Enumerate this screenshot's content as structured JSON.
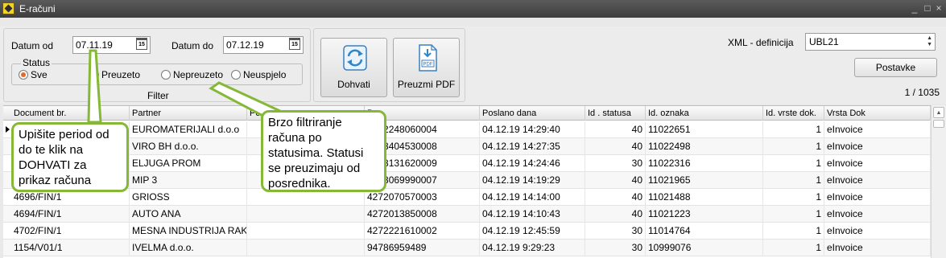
{
  "window": {
    "title": "E-računi",
    "controls": {
      "minimize": "_",
      "maximize": "□",
      "close": "×"
    }
  },
  "filter": {
    "date_from_label": "Datum od",
    "date_from_value": "07.11.19",
    "date_to_label": "Datum do",
    "date_to_value": "07.12.19",
    "calendar_glyph": "15",
    "status_label": "Status",
    "status_options": [
      {
        "label": "Sve",
        "selected": true
      },
      {
        "label": "Preuzeto",
        "selected": false
      },
      {
        "label": "Nepreuzeto",
        "selected": false
      },
      {
        "label": "Neuspjelo",
        "selected": false
      }
    ],
    "caption": "Filter"
  },
  "actions": {
    "fetch_label": "Dohvati",
    "download_pdf_label": "Preuzmi PDF",
    "pdf_icon_text": "PDF"
  },
  "xml": {
    "label": "XML - definicija",
    "value": "UBL21",
    "settings_label": "Postavke",
    "pager": "1 / 1035"
  },
  "table": {
    "columns": [
      "Document br.",
      "Partner",
      "Pos. je",
      "B",
      "Poslano dana",
      "Id . statusa",
      "Id. oznaka",
      "Id. vrste dok.",
      "Vrsta Dok"
    ],
    "rows": [
      {
        "doc": "",
        "partner": "EUROMATERIJALI d.o.o",
        "pos": "",
        "b": "4272248060004",
        "date": "04.12.19 14:29:40",
        "status": "40",
        "oznaka": "11022651",
        "vrste": "1",
        "vrsta": "eInvoice"
      },
      {
        "doc": "",
        "partner": "VIRO BH d.o.o.",
        "pos": "",
        "b": "4218404530008",
        "date": "04.12.19 14:27:35",
        "status": "40",
        "oznaka": "11022498",
        "vrste": "1",
        "vrsta": "eInvoice"
      },
      {
        "doc": "",
        "partner": "ELJUGA PROM",
        "pos": "",
        "b": "4218131620009",
        "date": "04.12.19 14:24:46",
        "status": "30",
        "oznaka": "11022316",
        "vrste": "1",
        "vrsta": "eInvoice"
      },
      {
        "doc": "",
        "partner": "MIP 3",
        "pos": "",
        "b": "4218069990007",
        "date": "04.12.19 14:19:29",
        "status": "40",
        "oznaka": "11021965",
        "vrste": "1",
        "vrsta": "eInvoice"
      },
      {
        "doc": "4696/FIN/1",
        "partner": "GRIOSS",
        "pos": "",
        "b": "4272070570003",
        "date": "04.12.19 14:14:00",
        "status": "40",
        "oznaka": "11021488",
        "vrste": "1",
        "vrsta": "eInvoice"
      },
      {
        "doc": "4694/FIN/1",
        "partner": "AUTO ANA",
        "pos": "",
        "b": "4272013850008",
        "date": "04.12.19 14:10:43",
        "status": "40",
        "oznaka": "11021223",
        "vrste": "1",
        "vrsta": "eInvoice"
      },
      {
        "doc": "4702/FIN/1",
        "partner": "MESNA INDUSTRIJA RAK",
        "pos": "",
        "b": "4272221610002",
        "date": "04.12.19 12:45:59",
        "status": "30",
        "oznaka": "11014764",
        "vrste": "1",
        "vrsta": "eInvoice"
      },
      {
        "doc": "1154/V01/1",
        "partner": "IVELMA d.o.o.",
        "pos": "",
        "b": "94786959489",
        "date": "04.12.19 9:29:23",
        "status": "30",
        "oznaka": "10999076",
        "vrste": "1",
        "vrsta": "eInvoice"
      }
    ]
  },
  "callouts": {
    "period": "Upišite period od do te klik na DOHVATI za prikaz računa",
    "status": "Brzo filtriranje računa po statusima. Statusi se preuzimaju od posrednika."
  },
  "colors": {
    "callout_border": "#86b837",
    "radio_selected": "#e36a2d",
    "titlebar": "#4a4a4a"
  }
}
